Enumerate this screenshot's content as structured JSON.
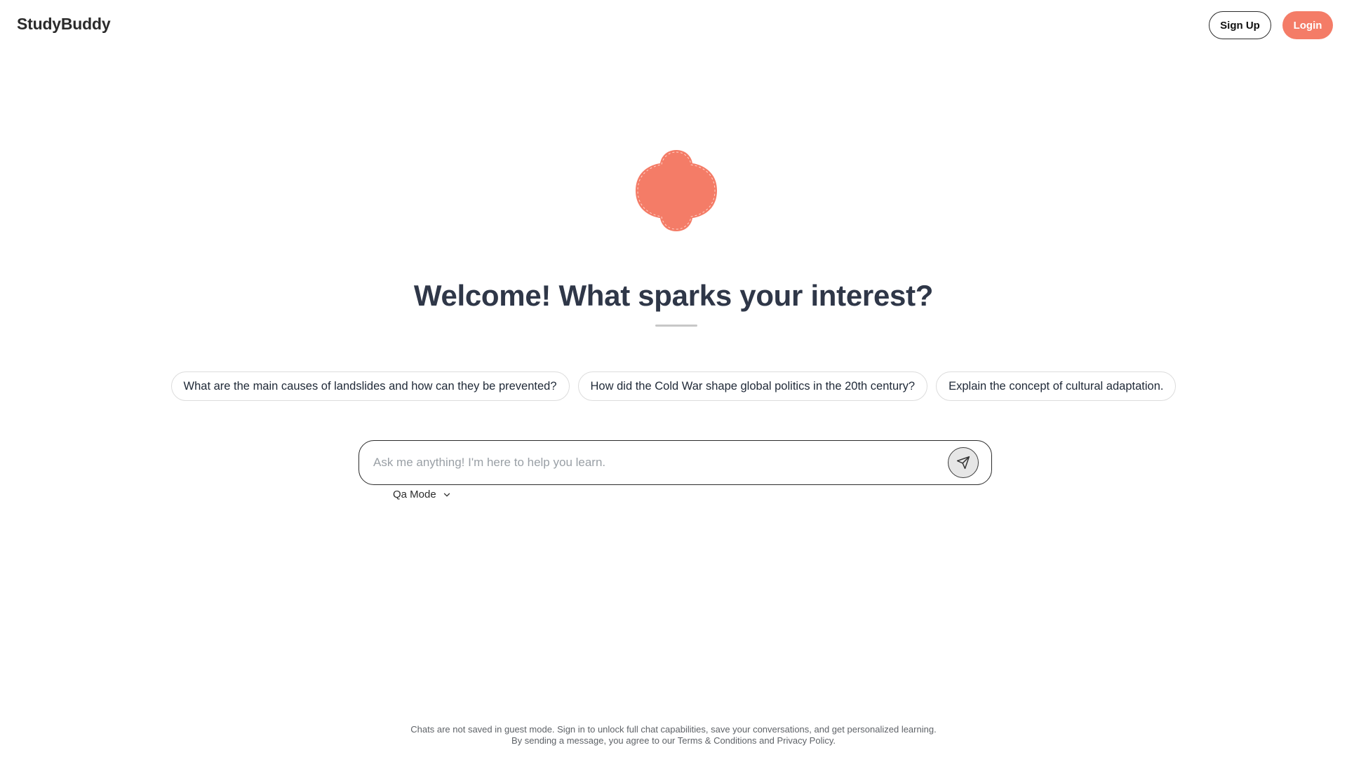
{
  "header": {
    "brand": "StudyBuddy",
    "signup_label": "Sign Up",
    "login_label": "Login"
  },
  "hero": {
    "logo_icon": "clover-blob-icon",
    "headline": "Welcome! What sparks your interest?"
  },
  "suggestions": [
    "What are the main causes of landslides and how can they be prevented?",
    "How did the Cold War shape global politics in the 20th century?",
    "Explain the concept of cultural adaptation."
  ],
  "composer": {
    "value": "",
    "placeholder": "Ask me anything! I'm here to help you learn.",
    "send_icon": "send-icon"
  },
  "mode": {
    "selected": "Qa Mode",
    "icon": "chevron-down-icon"
  },
  "footer": {
    "line1": "Chats are not saved in guest mode. Sign in to unlock full chat capabilities, save your conversations, and get personalized learning.",
    "line2_prefix": "By sending a message, you agree to our",
    "terms_link": "Terms & Conditions",
    "and_text": "and",
    "privacy_link": "Privacy Policy",
    "period": "."
  },
  "colors": {
    "accent": "#f47c67",
    "heading": "#2f3748",
    "border_dark": "#2b2b2b",
    "chip_border": "#dcdcdc",
    "muted_text": "#5f6368"
  }
}
